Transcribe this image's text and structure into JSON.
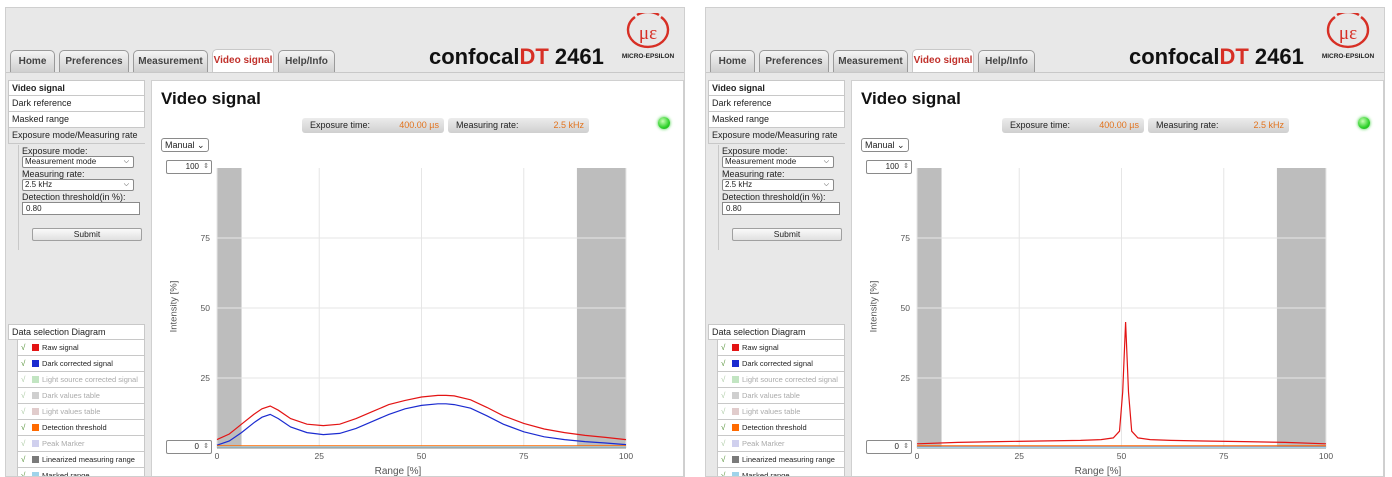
{
  "tabs": [
    "Home",
    "Preferences",
    "Measurement",
    "Video signal",
    "Help/Info"
  ],
  "active_tab": "Video signal",
  "brand": {
    "prefix": "confocal",
    "accent": "DT",
    "model": "2461",
    "accent_color": "#d72f25"
  },
  "logo": {
    "symbol": "με",
    "name": "MICRO-EPSILON"
  },
  "sidebar": [
    {
      "label": "Video signal"
    },
    {
      "label": "Dark reference"
    },
    {
      "label": "Masked range"
    },
    {
      "label": "Exposure mode/Measuring rate"
    }
  ],
  "form": {
    "exposure_mode_label": "Exposure mode:",
    "exposure_mode_value": "Measurement mode",
    "measuring_rate_label": "Measuring rate:",
    "measuring_rate_value": "2.5 kHz",
    "threshold_label": "Detection threshold(in %):",
    "threshold_value": "0.80",
    "submit_label": "Submit"
  },
  "data_selection": {
    "title": "Data selection Diagram",
    "items": [
      {
        "label": "Raw signal",
        "color": "#e31414",
        "enabled": true
      },
      {
        "label": "Dark corrected signal",
        "color": "#1b2bd0",
        "enabled": true
      },
      {
        "label": "Light source corrected signal",
        "color": "#8fd08f",
        "enabled": false
      },
      {
        "label": "Dark values table",
        "color": "#a8a8a8",
        "enabled": false
      },
      {
        "label": "Light values table",
        "color": "#c9a3a3",
        "enabled": false
      },
      {
        "label": "Detection threshold",
        "color": "#ff6a00",
        "enabled": true
      },
      {
        "label": "Peak Marker",
        "color": "#a9a9e0",
        "enabled": false
      },
      {
        "label": "Linearized measuring range",
        "color": "#7a7a7a",
        "enabled": true
      },
      {
        "label": "Masked range",
        "color": "#9fd3ea",
        "enabled": true
      }
    ]
  },
  "page_title": "Video signal",
  "info": {
    "exposure_label": "Exposure time:",
    "exposure_value": "400.00 µs",
    "rate_label": "Measuring rate:",
    "rate_value": "2.5 kHz"
  },
  "scale_mode": "Manual",
  "y_max_input": "100",
  "y_min_input": "0",
  "status_led_color": "#2ed12a",
  "chart_data": [
    {
      "type": "line",
      "xlabel": "Range [%]",
      "ylabel": "Intensity [%]",
      "xlim": [
        0,
        100
      ],
      "ylim": [
        0,
        100
      ],
      "xticks": [
        0,
        25,
        50,
        75,
        100
      ],
      "yticks": [
        25,
        50,
        75
      ],
      "grid": true,
      "masked_ranges": [
        [
          0,
          6
        ],
        [
          88,
          100
        ]
      ],
      "series": [
        {
          "name": "Raw signal",
          "color": "#e31414",
          "x": [
            0,
            3,
            6,
            9,
            11,
            13,
            15,
            18,
            22,
            26,
            30,
            34,
            38,
            42,
            46,
            50,
            54,
            56,
            58,
            62,
            66,
            70,
            75,
            80,
            85,
            90,
            95,
            100
          ],
          "y": [
            3,
            5,
            8.5,
            12,
            14,
            15,
            13.5,
            10.5,
            8.5,
            8,
            8.5,
            10.5,
            13,
            15.5,
            17,
            18.2,
            18.8,
            18.8,
            18.6,
            17.2,
            14.5,
            11.5,
            8.8,
            6.8,
            5.5,
            4.5,
            3.8,
            3
          ]
        },
        {
          "name": "Dark corrected signal",
          "color": "#1b2bd0",
          "x": [
            0,
            3,
            6,
            9,
            11,
            13,
            15,
            18,
            22,
            26,
            30,
            34,
            38,
            42,
            46,
            50,
            54,
            56,
            58,
            62,
            66,
            70,
            75,
            80,
            85,
            90,
            95,
            100
          ],
          "y": [
            1,
            2.5,
            5.5,
            9,
            11,
            12,
            10.5,
            7.5,
            5.5,
            4.8,
            5.2,
            7,
            9.5,
            12,
            14,
            15.2,
            15.8,
            15.8,
            15.5,
            14.2,
            11.5,
            8.5,
            5.8,
            4,
            3,
            2.3,
            1.8,
            1.2
          ]
        },
        {
          "name": "Detection threshold",
          "color": "#ff6a00",
          "x": [
            0,
            100
          ],
          "y": [
            0.8,
            0.8
          ]
        },
        {
          "name": "Masked range",
          "color": "#9fd3ea",
          "x": [
            0,
            100
          ],
          "y": [
            0.4,
            0.4
          ]
        }
      ]
    },
    {
      "type": "line",
      "xlabel": "Range [%]",
      "ylabel": "Intensity [%]",
      "xlim": [
        0,
        100
      ],
      "ylim": [
        0,
        100
      ],
      "xticks": [
        0,
        25,
        50,
        75,
        100
      ],
      "yticks": [
        25,
        50,
        75
      ],
      "grid": true,
      "masked_ranges": [
        [
          0,
          6
        ],
        [
          88,
          100
        ]
      ],
      "series": [
        {
          "name": "Raw signal",
          "color": "#e31414",
          "x": [
            0,
            10,
            20,
            30,
            40,
            45,
            48,
            49.5,
            50.3,
            51,
            51.7,
            52.5,
            54,
            57,
            62,
            70,
            80,
            90,
            100
          ],
          "y": [
            1.5,
            2,
            2.3,
            2.5,
            2.7,
            3,
            3.6,
            6,
            20,
            45,
            20,
            6,
            3.6,
            3,
            2.7,
            2.5,
            2.3,
            2,
            1.5
          ]
        },
        {
          "name": "Dark corrected signal",
          "color": "#1b2bd0",
          "x": [
            0,
            100
          ],
          "y": [
            0.3,
            0.3
          ]
        },
        {
          "name": "Detection threshold",
          "color": "#ff6a00",
          "x": [
            0,
            100
          ],
          "y": [
            0.8,
            0.8
          ]
        },
        {
          "name": "Masked range",
          "color": "#9fd3ea",
          "x": [
            0,
            100
          ],
          "y": [
            0.2,
            0.2
          ]
        }
      ]
    }
  ]
}
